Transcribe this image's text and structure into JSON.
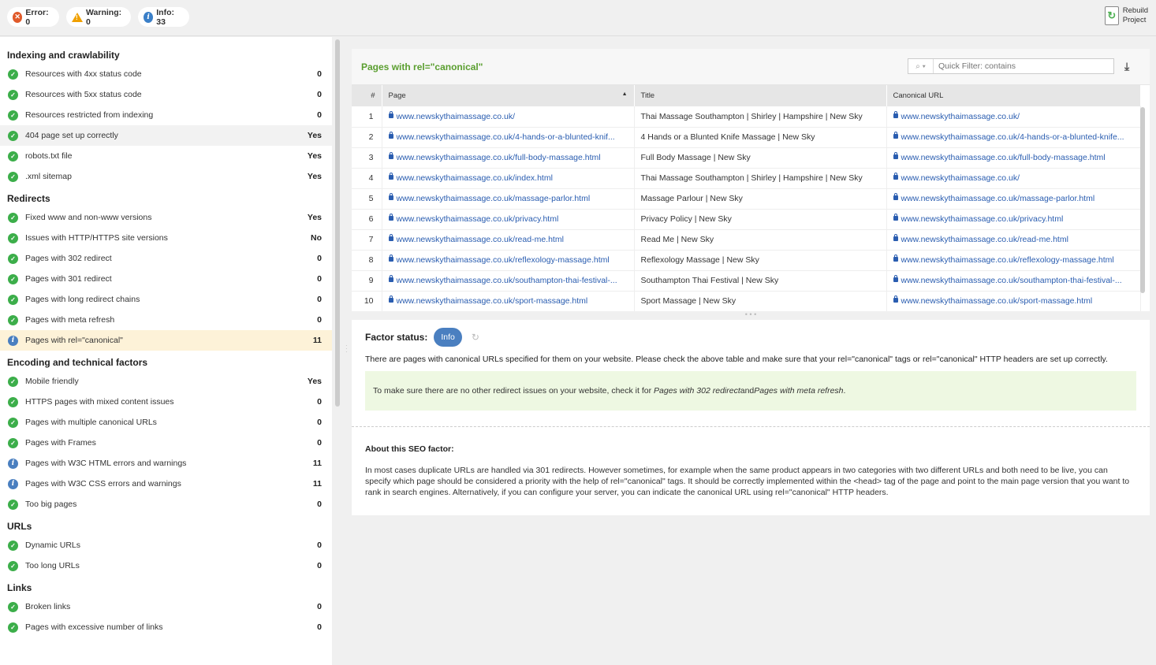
{
  "topbar": {
    "error_label": "Error: 0",
    "warning_label": "Warning: 0",
    "info_label": "Info: 33",
    "rebuild_line1": "Rebuild",
    "rebuild_line2": "Project"
  },
  "sidebar": {
    "sections": [
      {
        "title": "Indexing and crawlability",
        "items": [
          {
            "label": "Resources with 4xx status code",
            "value": "0",
            "status": "ok"
          },
          {
            "label": "Resources with 5xx status code",
            "value": "0",
            "status": "ok"
          },
          {
            "label": "Resources restricted from indexing",
            "value": "0",
            "status": "ok"
          },
          {
            "label": "404 page set up correctly",
            "value": "Yes",
            "status": "ok"
          },
          {
            "label": "robots.txt file",
            "value": "Yes",
            "status": "ok"
          },
          {
            "label": ".xml sitemap",
            "value": "Yes",
            "status": "ok"
          }
        ]
      },
      {
        "title": "Redirects",
        "items": [
          {
            "label": "Fixed www and non-www versions",
            "value": "Yes",
            "status": "ok"
          },
          {
            "label": "Issues with HTTP/HTTPS site versions",
            "value": "No",
            "status": "ok"
          },
          {
            "label": "Pages with 302 redirect",
            "value": "0",
            "status": "ok"
          },
          {
            "label": "Pages with 301 redirect",
            "value": "0",
            "status": "ok"
          },
          {
            "label": "Pages with long redirect chains",
            "value": "0",
            "status": "ok"
          },
          {
            "label": "Pages with meta refresh",
            "value": "0",
            "status": "ok"
          },
          {
            "label": "Pages with rel=\"canonical\"",
            "value": "11",
            "status": "info"
          }
        ]
      },
      {
        "title": "Encoding and technical factors",
        "items": [
          {
            "label": "Mobile friendly",
            "value": "Yes",
            "status": "ok"
          },
          {
            "label": "HTTPS pages with mixed content issues",
            "value": "0",
            "status": "ok"
          },
          {
            "label": "Pages with multiple canonical URLs",
            "value": "0",
            "status": "ok"
          },
          {
            "label": "Pages with Frames",
            "value": "0",
            "status": "ok"
          },
          {
            "label": "Pages with W3C HTML errors and warnings",
            "value": "11",
            "status": "info"
          },
          {
            "label": "Pages with W3C CSS errors and warnings",
            "value": "11",
            "status": "info"
          },
          {
            "label": "Too big pages",
            "value": "0",
            "status": "ok"
          }
        ]
      },
      {
        "title": "URLs",
        "items": [
          {
            "label": "Dynamic URLs",
            "value": "0",
            "status": "ok"
          },
          {
            "label": "Too long URLs",
            "value": "0",
            "status": "ok"
          }
        ]
      },
      {
        "title": "Links",
        "items": [
          {
            "label": "Broken links",
            "value": "0",
            "status": "ok"
          },
          {
            "label": "Pages with excessive number of links",
            "value": "0",
            "status": "ok"
          }
        ]
      }
    ]
  },
  "main": {
    "title": "Pages with rel=\"canonical\"",
    "filter_placeholder": "Quick Filter: contains",
    "columns": {
      "num": "#",
      "page": "Page",
      "title": "Title",
      "canonical": "Canonical URL"
    },
    "rows": [
      {
        "num": "1",
        "page": "www.newskythaimassage.co.uk/",
        "title": "Thai Massage Southampton | Shirley | Hampshire | New Sky",
        "canonical": "www.newskythaimassage.co.uk/"
      },
      {
        "num": "2",
        "page": "www.newskythaimassage.co.uk/4-hands-or-a-blunted-knif...",
        "title": "4 Hands or a Blunted Knife Massage | New Sky",
        "canonical": "www.newskythaimassage.co.uk/4-hands-or-a-blunted-knife..."
      },
      {
        "num": "3",
        "page": "www.newskythaimassage.co.uk/full-body-massage.html",
        "title": "Full Body Massage | New Sky",
        "canonical": "www.newskythaimassage.co.uk/full-body-massage.html"
      },
      {
        "num": "4",
        "page": "www.newskythaimassage.co.uk/index.html",
        "title": "Thai Massage Southampton | Shirley | Hampshire | New Sky",
        "canonical": "www.newskythaimassage.co.uk/"
      },
      {
        "num": "5",
        "page": "www.newskythaimassage.co.uk/massage-parlor.html",
        "title": "Massage Parlour | New Sky",
        "canonical": "www.newskythaimassage.co.uk/massage-parlor.html"
      },
      {
        "num": "6",
        "page": "www.newskythaimassage.co.uk/privacy.html",
        "title": "Privacy Policy | New Sky",
        "canonical": "www.newskythaimassage.co.uk/privacy.html"
      },
      {
        "num": "7",
        "page": "www.newskythaimassage.co.uk/read-me.html",
        "title": "Read Me | New Sky",
        "canonical": "www.newskythaimassage.co.uk/read-me.html"
      },
      {
        "num": "8",
        "page": "www.newskythaimassage.co.uk/reflexology-massage.html",
        "title": "Reflexology Massage | New Sky",
        "canonical": "www.newskythaimassage.co.uk/reflexology-massage.html"
      },
      {
        "num": "9",
        "page": "www.newskythaimassage.co.uk/southampton-thai-festival-...",
        "title": "Southampton Thai Festival | New Sky",
        "canonical": "www.newskythaimassage.co.uk/southampton-thai-festival-..."
      },
      {
        "num": "10",
        "page": "www.newskythaimassage.co.uk/sport-massage.html",
        "title": "Sport Massage | New Sky",
        "canonical": "www.newskythaimassage.co.uk/sport-massage.html"
      }
    ],
    "factor_label": "Factor status:",
    "factor_badge": "Info",
    "factor_desc": "There are pages with canonical URLs specified for them on your website. Please check the above table and make sure that your rel=\"canonical\" tags or rel=\"canonical\" HTTP headers are set up correctly.",
    "tip_prefix": "To make sure there are no other redirect issues on your website, check it for ",
    "tip_link1": "Pages with 302 redirect",
    "tip_and": " and ",
    "tip_link2": "Pages with meta refresh",
    "tip_suffix": ".",
    "about_title": "About this SEO factor:",
    "about_text": "In most cases duplicate URLs are handled via 301 redirects. However sometimes, for example when the same product appears in two categories with two different URLs and both need to be live, you can specify which page should be considered a priority with the help of rel=\"canonical\" tags. It should be correctly implemented within the <head> tag of the page and point to the main page version that you want to rank in search engines. Alternatively, if you can configure your server, you can indicate the canonical URL using rel=\"canonical\" HTTP headers."
  },
  "colors": {
    "accent_green": "#5a9e2f",
    "ok": "#3cae4a",
    "info": "#4a7fc0",
    "error": "#e05a2a",
    "warning": "#f0a000",
    "selected_row": "#fdf2d8"
  }
}
